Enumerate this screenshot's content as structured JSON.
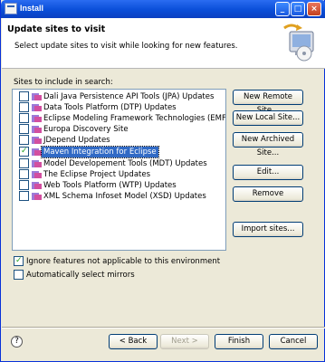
{
  "window": {
    "title": "Install"
  },
  "header": {
    "title": "Update sites to visit",
    "description": "Select update sites to visit while looking for new features."
  },
  "sites": {
    "label": "Sites to include in search:",
    "items": [
      {
        "label": "Dali Java Persistence API Tools (JPA) Updates",
        "checked": false,
        "selected": false
      },
      {
        "label": "Data Tools Platform (DTP) Updates",
        "checked": false,
        "selected": false
      },
      {
        "label": "Eclipse Modeling Framework Technologies (EMFT) Updat",
        "checked": false,
        "selected": false
      },
      {
        "label": "Europa Discovery Site",
        "checked": false,
        "selected": false
      },
      {
        "label": "JDepend Updates",
        "checked": false,
        "selected": false
      },
      {
        "label": "Maven Integration for Eclipse",
        "checked": true,
        "selected": true
      },
      {
        "label": "Model Developement Tools (MDT) Updates",
        "checked": false,
        "selected": false
      },
      {
        "label": "The Eclipse Project Updates",
        "checked": false,
        "selected": false
      },
      {
        "label": "Web Tools Platform (WTP) Updates",
        "checked": false,
        "selected": false
      },
      {
        "label": "XML Schema Infoset Model (XSD) Updates",
        "checked": false,
        "selected": false
      }
    ]
  },
  "side_buttons": {
    "new_remote": "New Remote Site...",
    "new_local": "New Local Site...",
    "new_archived": "New Archived Site...",
    "edit": "Edit...",
    "remove": "Remove",
    "import": "Import sites..."
  },
  "options": {
    "ignore_features": {
      "label": "Ignore features not applicable to this environment",
      "checked": true
    },
    "auto_mirrors": {
      "label": "Automatically select mirrors",
      "checked": false
    }
  },
  "footer": {
    "back": "< Back",
    "next": "Next >",
    "finish": "Finish",
    "cancel": "Cancel"
  }
}
